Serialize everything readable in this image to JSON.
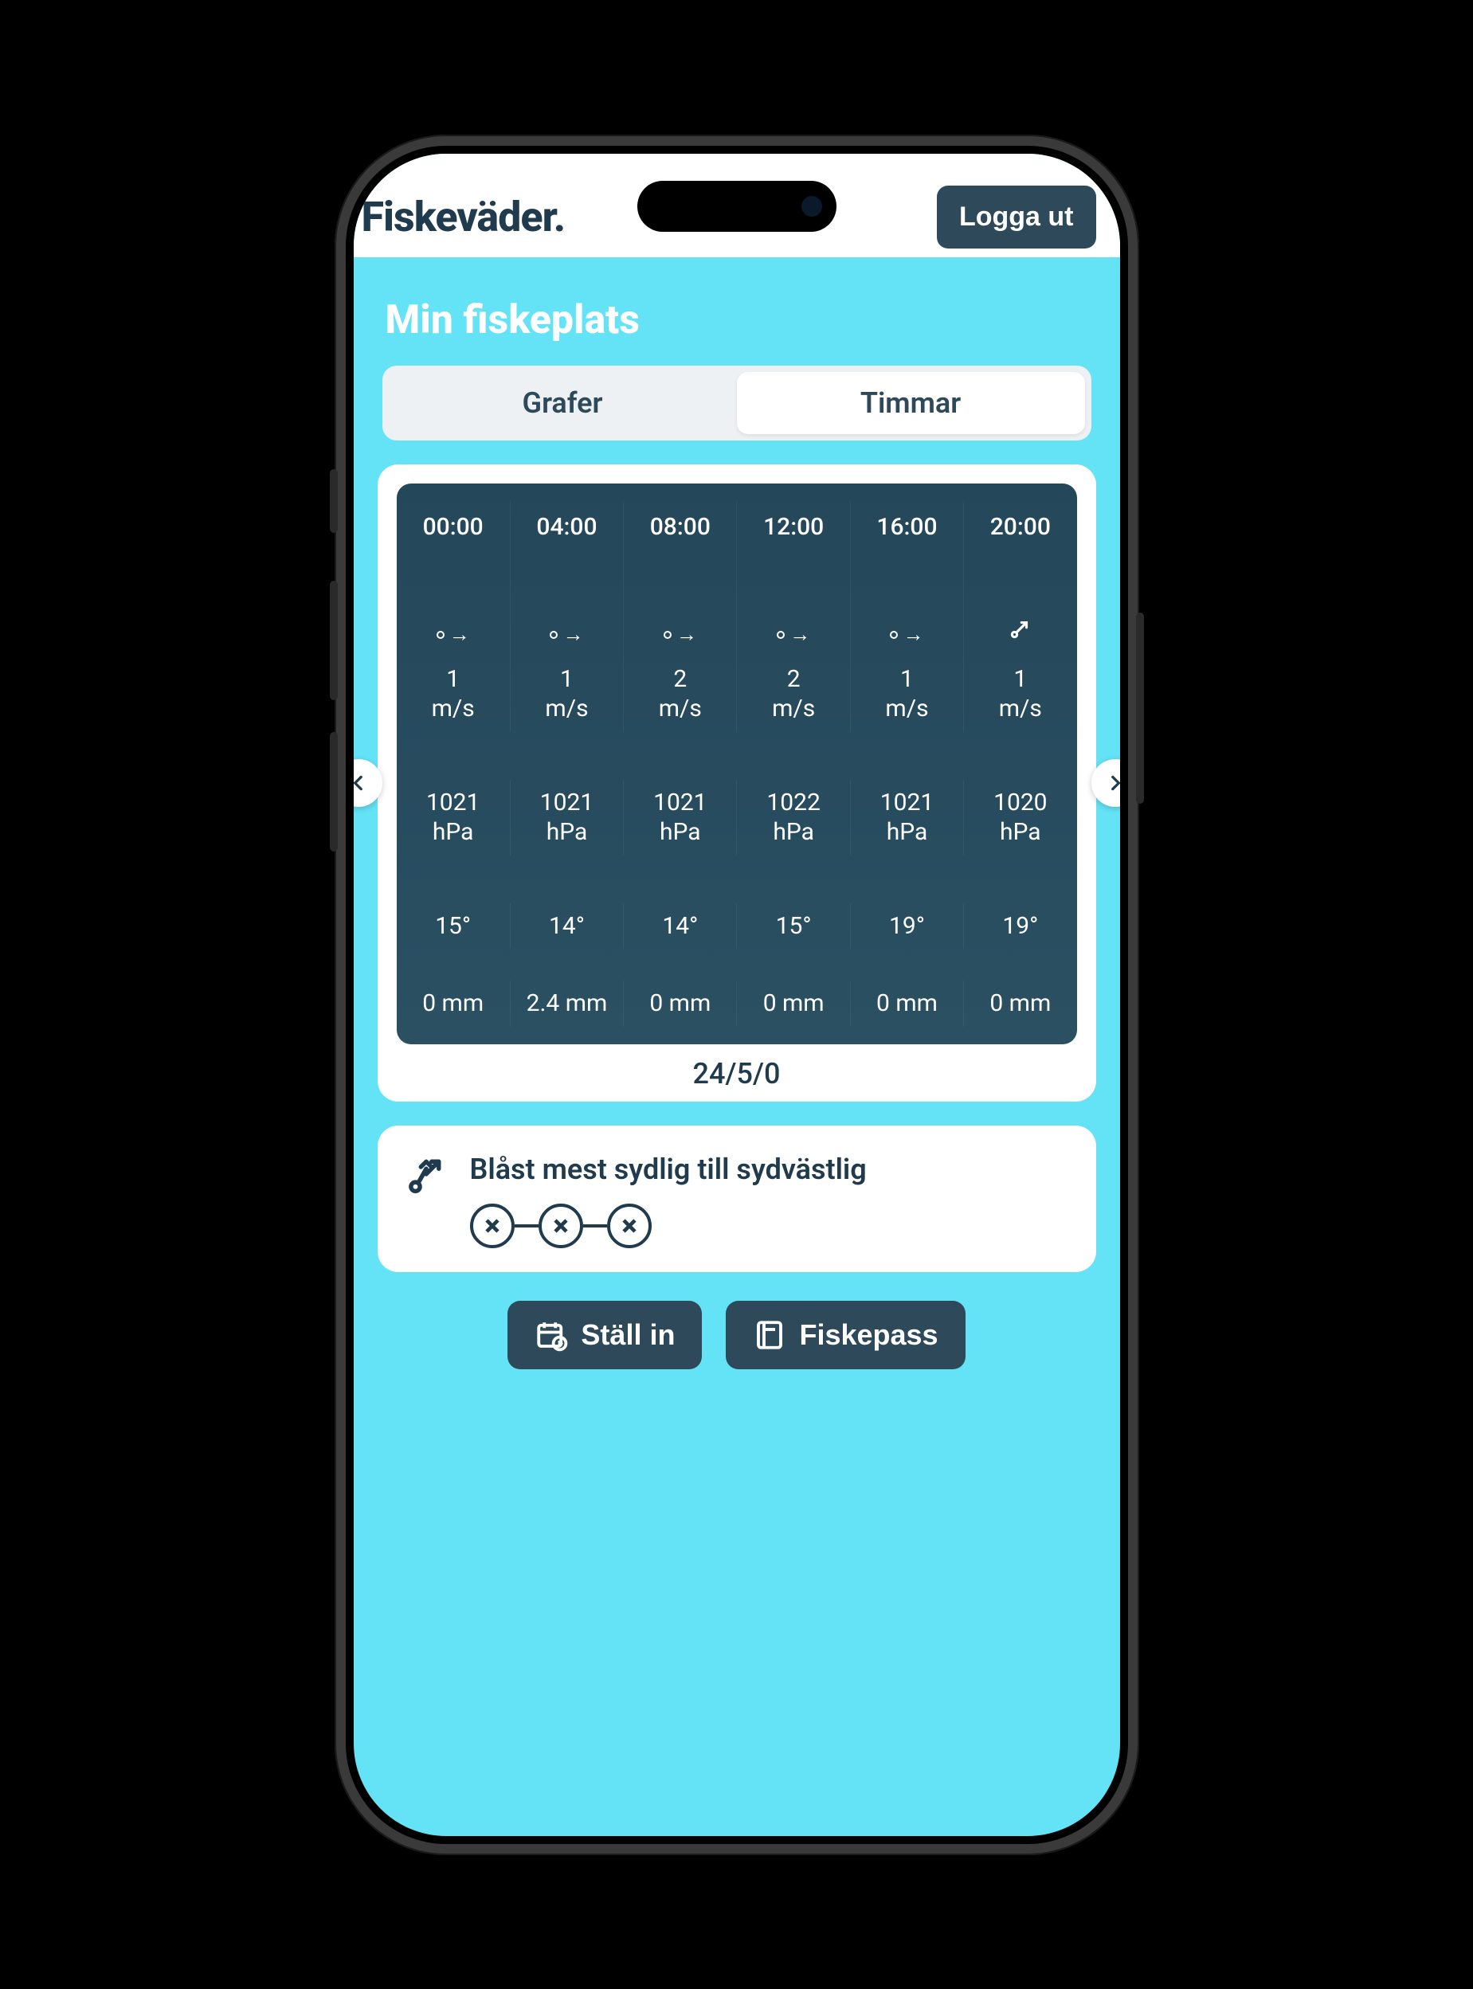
{
  "header": {
    "app_title": "Fiskeväder.",
    "logout_label": "Logga ut"
  },
  "page": {
    "title": "Min fiskeplats"
  },
  "tabs": {
    "graphs_label": "Grafer",
    "hours_label": "Timmar",
    "active": "hours"
  },
  "hours": {
    "times": [
      "00:00",
      "04:00",
      "08:00",
      "12:00",
      "16:00",
      "20:00"
    ],
    "wind_direction_icons": [
      "right",
      "right",
      "right",
      "right",
      "right",
      "diag-ne"
    ],
    "wind_speed_values": [
      "1",
      "1",
      "2",
      "2",
      "1",
      "1"
    ],
    "wind_speed_unit": "m/s",
    "pressure_values": [
      "1021",
      "1021",
      "1021",
      "1022",
      "1021",
      "1020"
    ],
    "pressure_unit": "hPa",
    "temperature_values": [
      "15°",
      "14°",
      "14°",
      "15°",
      "19°",
      "19°"
    ],
    "precip_values": [
      "0 mm",
      "2.4 mm",
      "0 mm",
      "0 mm",
      "0 mm",
      "0 mm"
    ],
    "date_label": "24/5/0"
  },
  "summary": {
    "text": "Blåst mest sydlig till sydvästlig",
    "rating_count": 3
  },
  "actions": {
    "settings_label": "Ställ in",
    "fishpass_label": "Fiskepass"
  }
}
